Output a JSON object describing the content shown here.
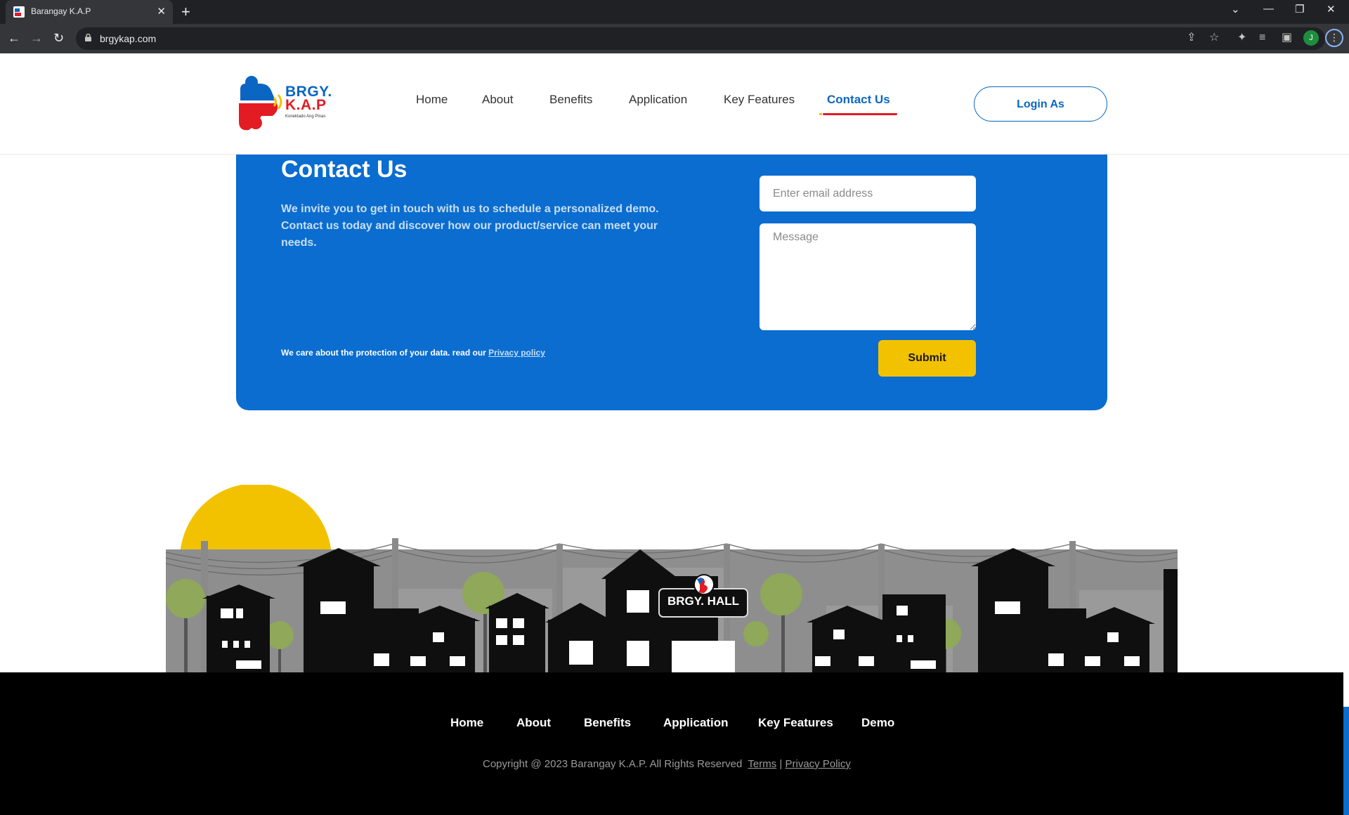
{
  "browser": {
    "tab_title": "Barangay K.A.P",
    "url": "brgykap.com",
    "profile_initial": "J",
    "icons": [
      "back-icon",
      "forward-icon",
      "reload-icon",
      "lock-icon",
      "share-icon",
      "star-icon",
      "extensions-icon",
      "media-icon",
      "sidepanel-icon",
      "menu-icon"
    ]
  },
  "logo": {
    "line1": "BRGY.",
    "line2": "K.A.P",
    "tagline": "Konektado Ang Pinas"
  },
  "nav": {
    "items": [
      "Home",
      "About",
      "Benefits",
      "Application",
      "Key Features",
      "Contact Us"
    ],
    "active": "Contact Us",
    "login_label": "Login As"
  },
  "contact": {
    "title": "Contact Us",
    "description": "We invite you to get in touch with us to schedule a personalized demo. Contact us today and discover how our product/service can meet your needs.",
    "privacy_text": "We care about the protection of your data. read our",
    "privacy_link": "Privacy policy",
    "email_placeholder": "Enter email address",
    "message_placeholder": "Message",
    "submit_label": "Submit"
  },
  "illustration": {
    "hall_sign": "BRGY. HALL"
  },
  "footer": {
    "nav": [
      "Home",
      "About",
      "Benefits",
      "Application",
      "Key Features",
      "Demo"
    ],
    "copyright": "Copyright @ 2023 Barangay K.A.P. All Rights Reserved",
    "terms": "Terms",
    "separator": "|",
    "privacy": "Privacy Policy"
  },
  "colors": {
    "brand_blue": "#0a6dcf",
    "brand_red": "#e31b23",
    "brand_yellow": "#f2c200",
    "footer_bg": "#000000"
  }
}
